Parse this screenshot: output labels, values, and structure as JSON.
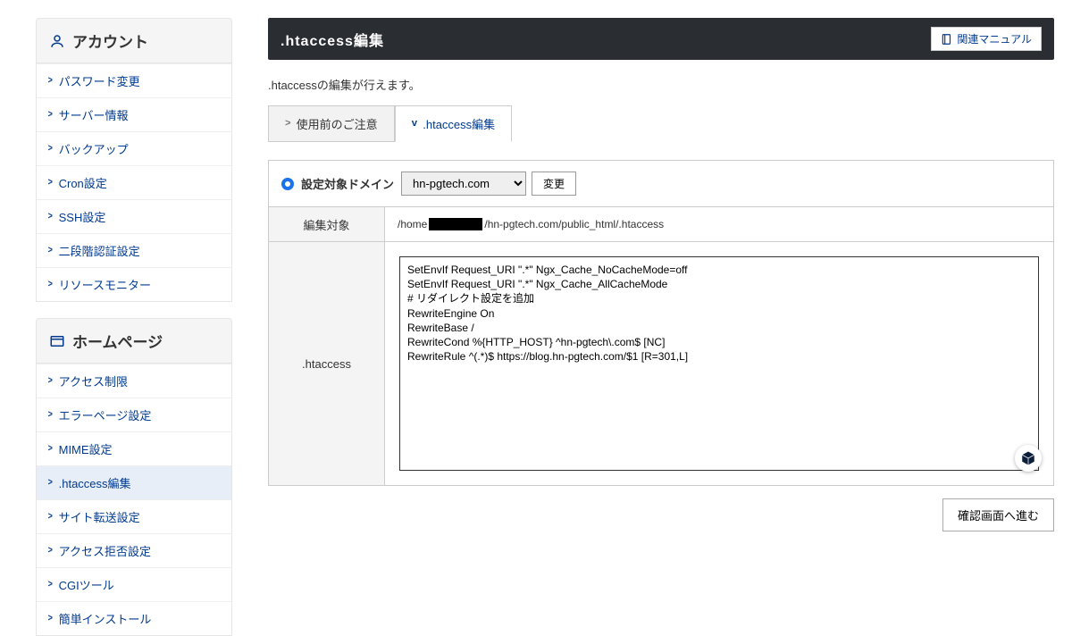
{
  "sidebar": {
    "sections": [
      {
        "title": "アカウント",
        "icon": "user-icon",
        "items": [
          {
            "label": "パスワード変更",
            "active": false,
            "name": "sidebar-item-password"
          },
          {
            "label": "サーバー情報",
            "active": false,
            "name": "sidebar-item-serverinfo"
          },
          {
            "label": "バックアップ",
            "active": false,
            "name": "sidebar-item-backup"
          },
          {
            "label": "Cron設定",
            "active": false,
            "name": "sidebar-item-cron"
          },
          {
            "label": "SSH設定",
            "active": false,
            "name": "sidebar-item-ssh"
          },
          {
            "label": "二段階認証設定",
            "active": false,
            "name": "sidebar-item-2fa"
          },
          {
            "label": "リソースモニター",
            "active": false,
            "name": "sidebar-item-resource"
          }
        ]
      },
      {
        "title": "ホームページ",
        "icon": "window-icon",
        "items": [
          {
            "label": "アクセス制限",
            "active": false,
            "name": "sidebar-item-access"
          },
          {
            "label": "エラーページ設定",
            "active": false,
            "name": "sidebar-item-error"
          },
          {
            "label": "MIME設定",
            "active": false,
            "name": "sidebar-item-mime"
          },
          {
            "label": ".htaccess編集",
            "active": true,
            "name": "sidebar-item-htaccess"
          },
          {
            "label": "サイト転送設定",
            "active": false,
            "name": "sidebar-item-forward"
          },
          {
            "label": "アクセス拒否設定",
            "active": false,
            "name": "sidebar-item-deny"
          },
          {
            "label": "CGIツール",
            "active": false,
            "name": "sidebar-item-cgi"
          },
          {
            "label": "簡単インストール",
            "active": false,
            "name": "sidebar-item-install"
          }
        ]
      }
    ]
  },
  "header": {
    "title": ".htaccess編集",
    "manual_label": "関連マニュアル"
  },
  "description": ".htaccessの編集が行えます。",
  "tabs": [
    {
      "label": "使用前のご注意",
      "active": false,
      "chev": ">",
      "name": "tab-notice"
    },
    {
      "label": ".htaccess編集",
      "active": true,
      "chev": "v",
      "name": "tab-edit"
    }
  ],
  "form": {
    "domain_row_label": "設定対象ドメイン",
    "domain_options": [
      "hn-pgtech.com"
    ],
    "domain_selected": "hn-pgtech.com",
    "change_label": "変更",
    "target_row_label": "編集対象",
    "path_prefix": "/home",
    "path_suffix": "/hn-pgtech.com/public_html/.htaccess",
    "editor_label": ".htaccess",
    "editor_value": "SetEnvIf Request_URI \".*\" Ngx_Cache_NoCacheMode=off\nSetEnvIf Request_URI \".*\" Ngx_Cache_AllCacheMode\n# リダイレクト設定を追加\nRewriteEngine On\nRewriteBase /\nRewriteCond %{HTTP_HOST} ^hn-pgtech\\.com$ [NC]\nRewriteRule ^(.*)$ https://blog.hn-pgtech.com/$1 [R=301,L]",
    "submit_label": "確認画面へ進む"
  }
}
